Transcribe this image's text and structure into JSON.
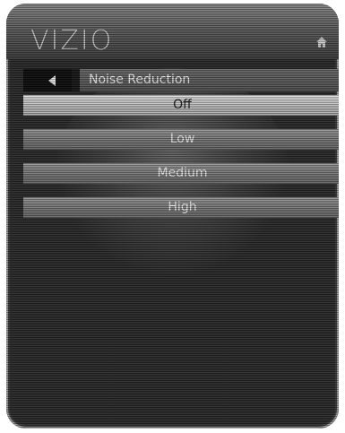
{
  "brand": {
    "logo_text": "VIZIO"
  },
  "header": {
    "home_icon": "home-icon"
  },
  "menu": {
    "title": "Noise Reduction",
    "back_icon": "back-arrow-icon",
    "options": [
      {
        "label": "Off",
        "selected": true
      },
      {
        "label": "Low",
        "selected": false
      },
      {
        "label": "Medium",
        "selected": false
      },
      {
        "label": "High",
        "selected": false
      }
    ]
  },
  "colors": {
    "panel": "#2a2a2a",
    "selected_option": "#c4c4c4",
    "option": "#7a7a7a",
    "title_bar": "#505050"
  }
}
